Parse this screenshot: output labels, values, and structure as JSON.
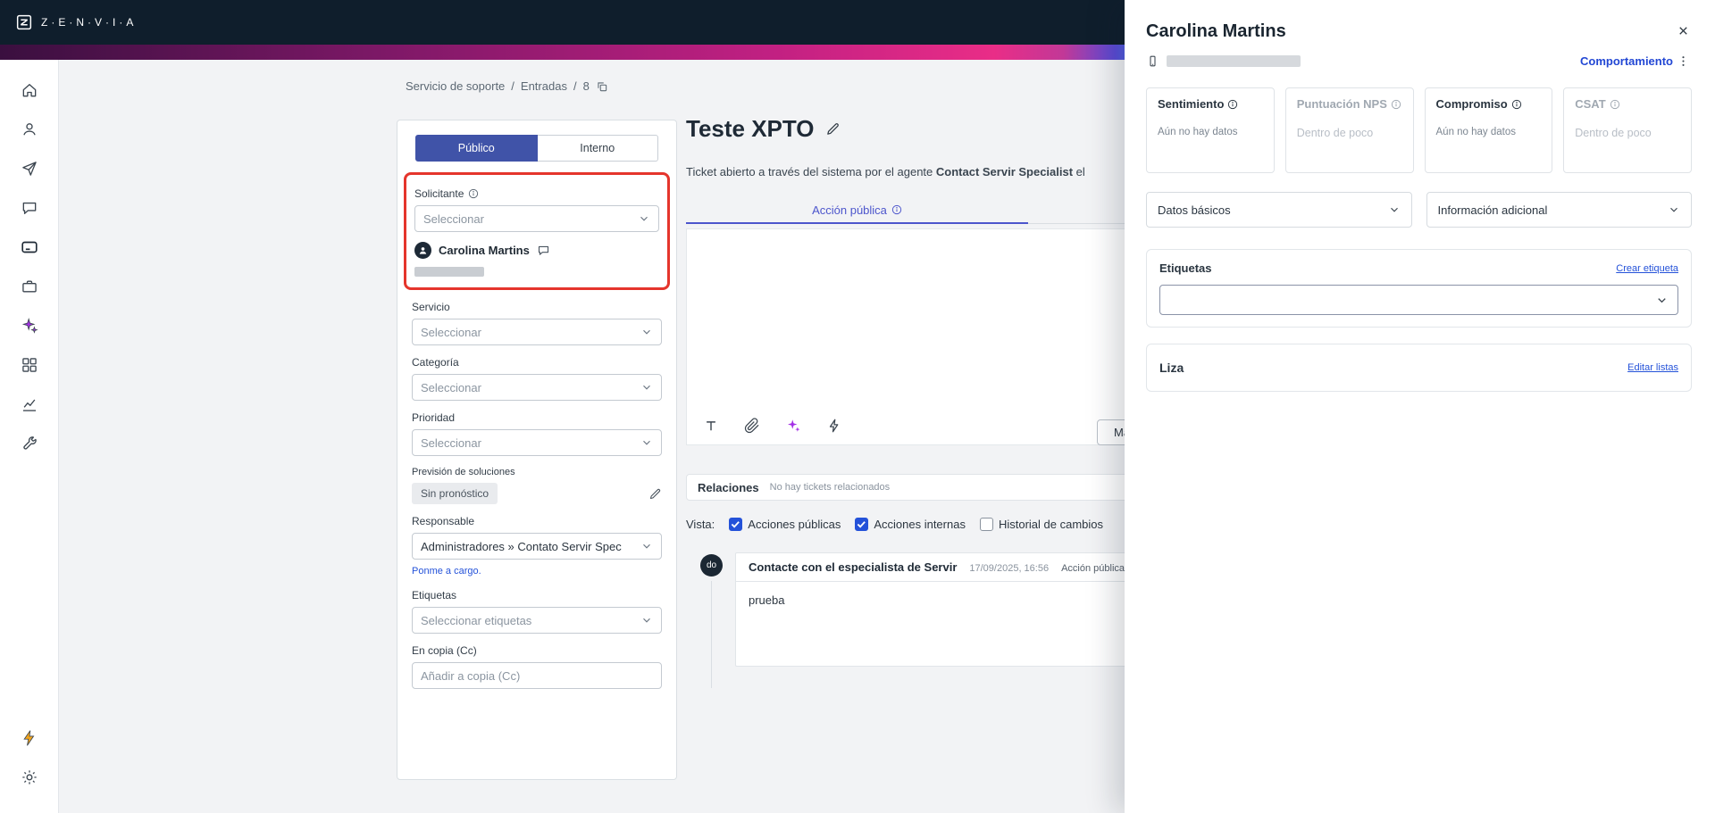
{
  "header": {
    "logo_text": "Z·E·N·V·I·A"
  },
  "sidebar": {
    "icons": [
      "home",
      "contacts",
      "send",
      "chat",
      "tickets",
      "toolbox",
      "ai-sparkles",
      "modules",
      "analytics",
      "tools"
    ],
    "bottom_icons": [
      "quick-access",
      "settings"
    ],
    "active": "tickets"
  },
  "breadcrumb": {
    "items": [
      "Servicio de soporte",
      "Entradas",
      "8"
    ],
    "separator": "/"
  },
  "form": {
    "tabs": {
      "public": "Público",
      "internal": "Interno"
    },
    "requester_label": "Solicitante",
    "requester_placeholder": "Seleccionar",
    "contact_name": "Carolina Martins",
    "service_label": "Servicio",
    "service_placeholder": "Seleccionar",
    "category_label": "Categoría",
    "category_placeholder": "Seleccionar",
    "priority_label": "Prioridad",
    "priority_placeholder": "Seleccionar",
    "forecast_label": "Previsión de soluciones",
    "forecast_value": "Sin pronóstico",
    "assignee_label": "Responsable",
    "assignee_value": "Administradores » Contato Servir Spec",
    "self_assign_link": "Ponme a cargo.",
    "tags_label": "Etiquetas",
    "tags_placeholder": "Seleccionar etiquetas",
    "cc_label": "En copia (Cc)",
    "cc_placeholder": "Añadir a copia (Cc)"
  },
  "ticket": {
    "title": "Teste XPTO",
    "description_prefix": "Ticket abierto a través del sistema por el agente ",
    "description_agent": "Contact Servir Specialist",
    "description_suffix": " el",
    "action_tab": "Acción pública",
    "toolbar_icons": [
      "text-format",
      "attachment",
      "ai-assist",
      "quick-reply"
    ],
    "partial_button": "Mar",
    "relations_title": "Relaciones",
    "relations_empty": "No hay tickets relacionados",
    "view_label": "Vista:",
    "view_options": [
      {
        "label": "Acciones públicas",
        "checked": true
      },
      {
        "label": "Acciones internas",
        "checked": true
      },
      {
        "label": "Historial de cambios",
        "checked": false
      }
    ],
    "entry": {
      "avatar_initials": "do",
      "author": "Contacte con el especialista de Servir",
      "timestamp": "17/09/2025, 16:56",
      "action_type": "Acción pública",
      "body": "prueba"
    }
  },
  "panel": {
    "name": "Carolina Martins",
    "behavior_link": "Comportamiento",
    "metrics": [
      {
        "title": "Sentimiento",
        "value": "Aún no hay datos",
        "disabled": false
      },
      {
        "title": "Puntuación NPS",
        "value": "Dentro de poco",
        "disabled": true
      },
      {
        "title": "Compromiso",
        "value": "Aún no hay datos",
        "disabled": false
      },
      {
        "title": "CSAT",
        "value": "Dentro de poco",
        "disabled": true
      }
    ],
    "accordion_left": "Datos básicos",
    "accordion_right": "Información adicional",
    "tags_title": "Etiquetas",
    "tags_action": "Crear etiqueta",
    "lists_title": "Liza",
    "lists_action": "Editar listas"
  },
  "colors": {
    "topbar": "#0f1e2c",
    "accent_blue": "#2452d9",
    "tab_blue": "#4053a8",
    "action_tab_indigo": "#4c55cc",
    "annotation_red": "#e5352c",
    "ai_purple": "#a32ee6",
    "flash_orange": "#f2a51c",
    "gradient_magenta": "#e92d87"
  }
}
